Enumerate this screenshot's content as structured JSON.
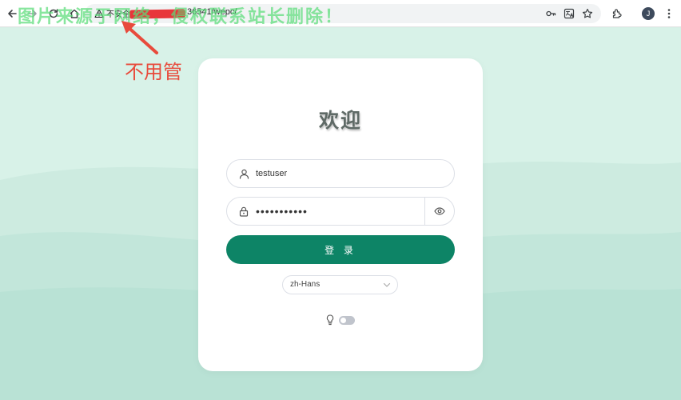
{
  "browser": {
    "security_label": "不安全",
    "url": "36541/wepc/",
    "profile_initial": "J",
    "icons": [
      "back-icon",
      "forward-icon",
      "reload-icon",
      "home-icon",
      "warning-icon",
      "key-icon",
      "translate-icon",
      "star-icon",
      "extensions-icon",
      "menu-icon"
    ]
  },
  "watermark": "图片来源于网络，侵权联系站长删除！",
  "annotation": {
    "text": "不用管",
    "color": "#e84b3c"
  },
  "login": {
    "heading": "欢迎",
    "username": {
      "value": "testuser",
      "icon": "user-icon"
    },
    "password": {
      "value": "•••••••••••",
      "icon": "lock-icon",
      "toggle_icon": "eye-icon"
    },
    "submit_label": "登 录",
    "language": {
      "selected": "zh-Hans"
    },
    "theme": {
      "icon": "lightbulb-icon",
      "dark_mode": false
    }
  },
  "colors": {
    "primary": "#0d8466",
    "background": "#d6f0e6",
    "annotation": "#e84b3c",
    "watermark": "#5adc78"
  }
}
